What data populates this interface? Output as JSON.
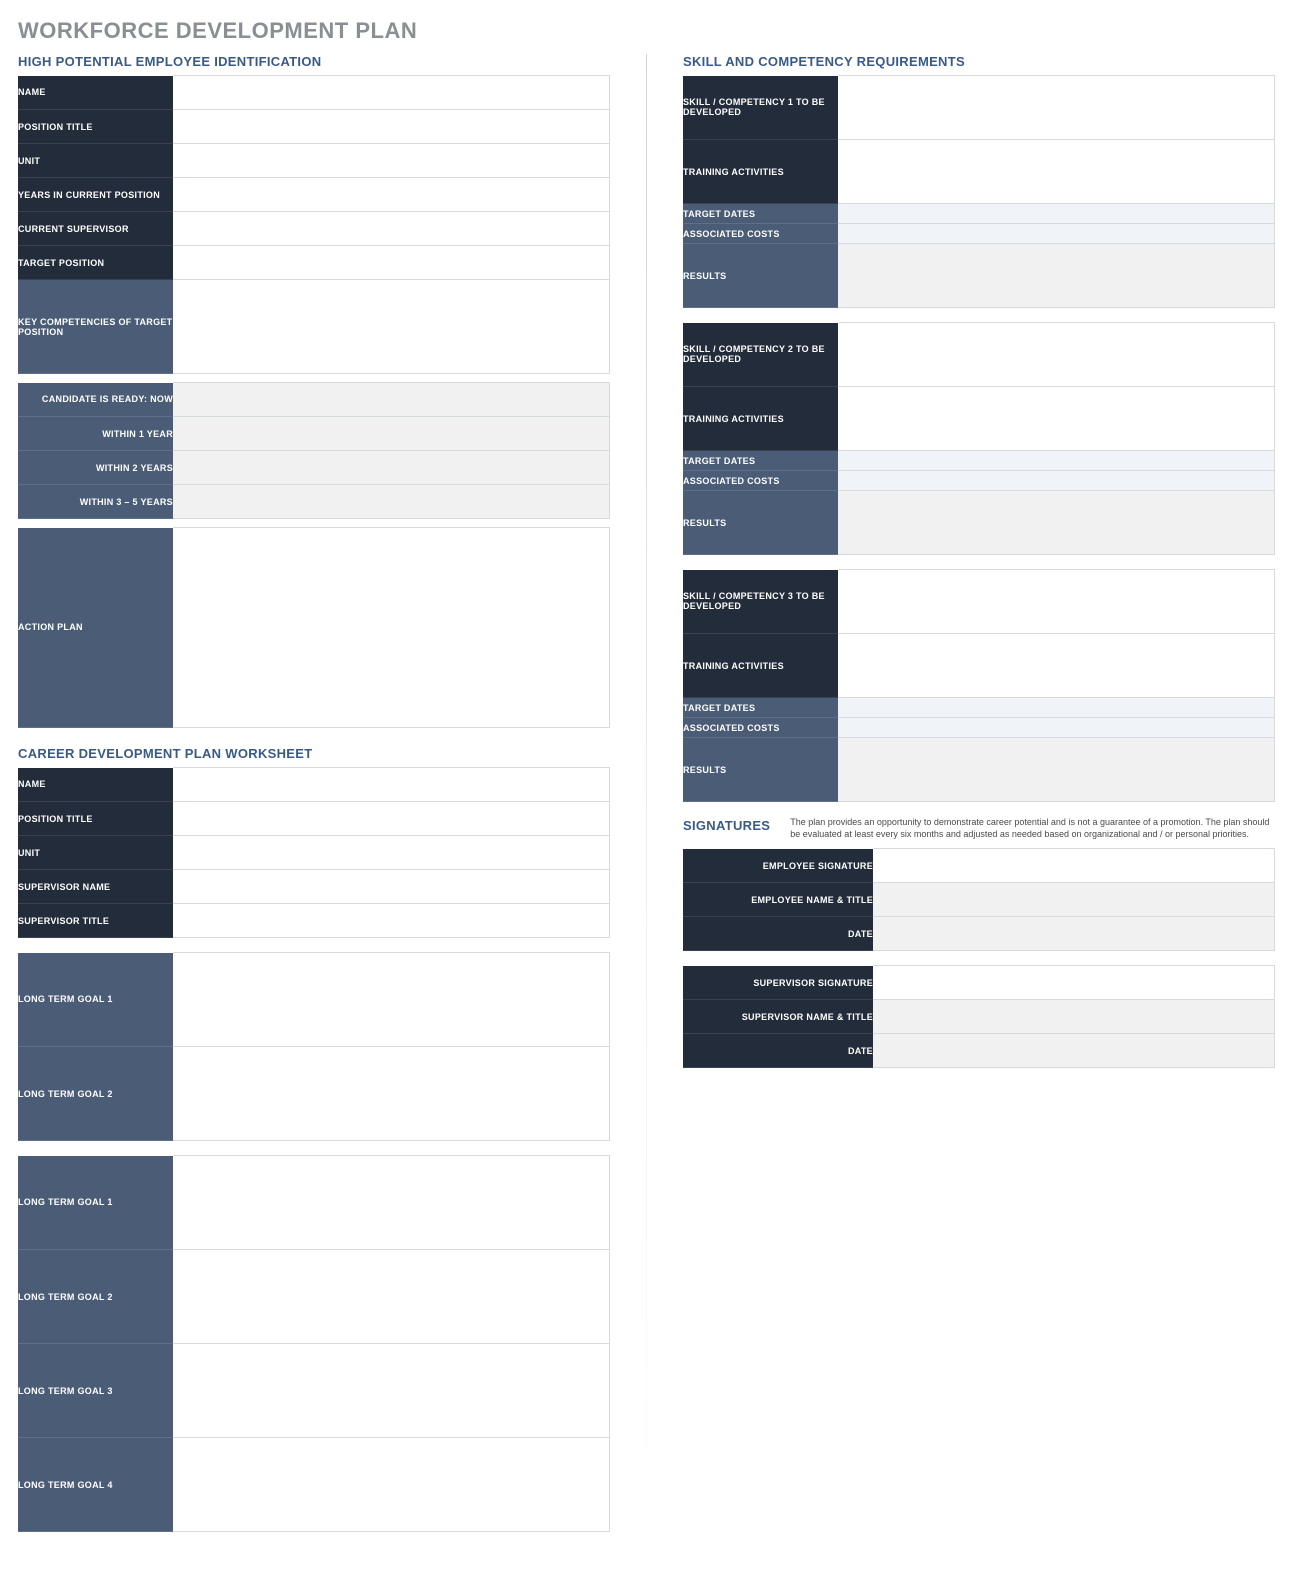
{
  "page_title": "WORKFORCE DEVELOPMENT PLAN",
  "left": {
    "high_potential": {
      "heading": "HIGH POTENTIAL EMPLOYEE IDENTIFICATION",
      "fields": {
        "name": "NAME",
        "position_title": "POSITION TITLE",
        "unit": "UNIT",
        "years_in_position": "YEARS IN CURRENT POSITION",
        "current_supervisor": "CURRENT SUPERVISOR",
        "target_position": "TARGET POSITION",
        "key_competencies": "KEY COMPETENCIES OF TARGET POSITION"
      },
      "readiness": {
        "now": "CANDIDATE IS READY:  NOW",
        "y1": "WITHIN 1 YEAR",
        "y2": "WITHIN 2 YEARS",
        "y35": "WITHIN 3 – 5 YEARS"
      },
      "action_plan_label": "ACTION PLAN"
    },
    "career_dev": {
      "heading": "CAREER DEVELOPMENT PLAN WORKSHEET",
      "fields": {
        "name": "NAME",
        "position_title": "POSITION TITLE",
        "unit": "UNIT",
        "supervisor_name": "SUPERVISOR NAME",
        "supervisor_title": "SUPERVISOR TITLE"
      },
      "long_term_goals_a": {
        "g1": "LONG TERM GOAL 1",
        "g2": "LONG TERM GOAL 2"
      },
      "long_term_goals_b": {
        "g1": "LONG TERM GOAL 1",
        "g2": "LONG TERM GOAL 2",
        "g3": "LONG TERM GOAL 3",
        "g4": "LONG TERM GOAL 4"
      }
    }
  },
  "right": {
    "skill_req": {
      "heading": "SKILL AND COMPETENCY REQUIREMENTS",
      "blocks": [
        {
          "sc": "SKILL / COMPETENCY 1 TO BE DEVELOPED",
          "ta": "TRAINING ACTIVITIES",
          "td": "TARGET DATES",
          "ac": "ASSOCIATED COSTS",
          "res": "RESULTS"
        },
        {
          "sc": "SKILL / COMPETENCY 2 TO BE DEVELOPED",
          "ta": "TRAINING ACTIVITIES",
          "td": "TARGET DATES",
          "ac": "ASSOCIATED COSTS",
          "res": "RESULTS"
        },
        {
          "sc": "SKILL / COMPETENCY 3 TO BE DEVELOPED",
          "ta": "TRAINING ACTIVITIES",
          "td": "TARGET DATES",
          "ac": "ASSOCIATED COSTS",
          "res": "RESULTS"
        }
      ]
    },
    "signatures": {
      "heading": "SIGNATURES",
      "note": "The plan provides an opportunity to demonstrate career potential and is not a guarantee of a promotion. The plan should be evaluated at least every six months and adjusted as needed based on organizational and / or personal priorities.",
      "employee": {
        "sig": "EMPLOYEE SIGNATURE",
        "name": "EMPLOYEE NAME & TITLE",
        "date": "DATE"
      },
      "supervisor": {
        "sig": "SUPERVISOR SIGNATURE",
        "name": "SUPERVISOR NAME & TITLE",
        "date": "DATE"
      }
    }
  }
}
